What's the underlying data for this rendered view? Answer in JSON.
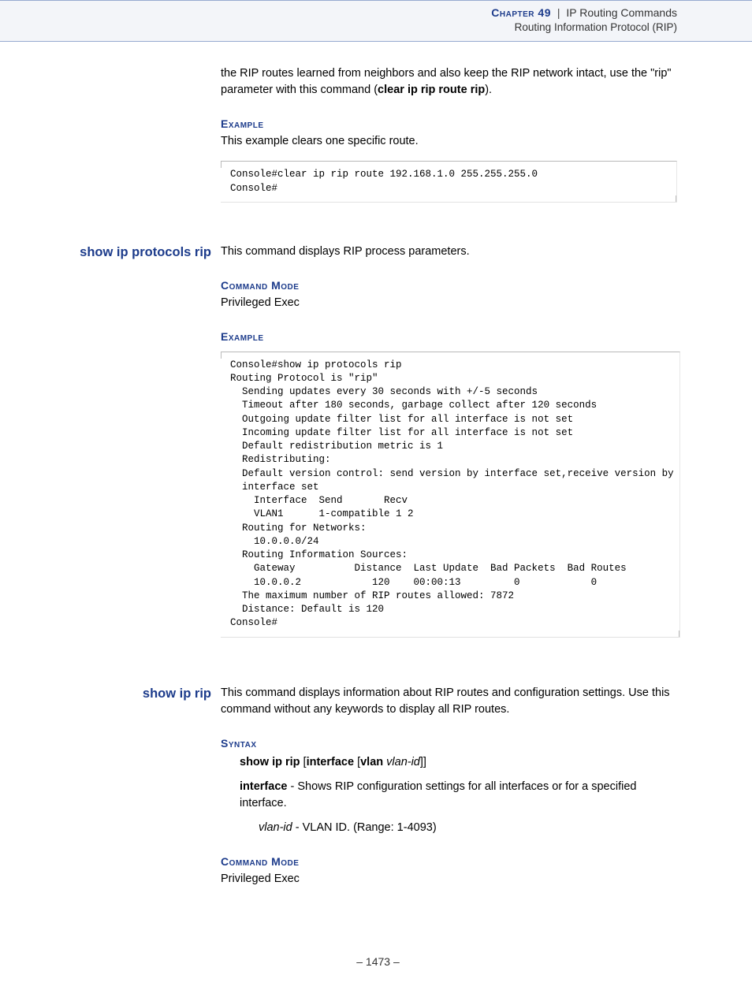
{
  "header": {
    "chapter_label": "Chapter 49",
    "sep": "|",
    "title1": "IP Routing Commands",
    "title2": "Routing Information Protocol (RIP)"
  },
  "intro": {
    "para_pre": "the RIP routes learned from neighbors and also keep the RIP network intact, use the \"rip\" parameter with this command (",
    "para_bold": "clear ip rip route rip",
    "para_post": ").",
    "example_head": "Example",
    "example_text": "This example clears one specific route.",
    "code": "Console#clear ip rip route 192.168.1.0 255.255.255.0\nConsole#"
  },
  "cmd1": {
    "name": "show ip protocols rip",
    "desc": "This command displays RIP process parameters.",
    "mode_head": "Command Mode",
    "mode_text": "Privileged Exec",
    "example_head": "Example",
    "code": "Console#show ip protocols rip\nRouting Protocol is \"rip\"\n  Sending updates every 30 seconds with +/-5 seconds\n  Timeout after 180 seconds, garbage collect after 120 seconds\n  Outgoing update filter list for all interface is not set\n  Incoming update filter list for all interface is not set\n  Default redistribution metric is 1\n  Redistributing:\n  Default version control: send version by interface set,receive version by \n  interface set\n    Interface  Send       Recv\n    VLAN1      1-compatible 1 2\n  Routing for Networks:\n    10.0.0.0/24\n  Routing Information Sources:\n    Gateway          Distance  Last Update  Bad Packets  Bad Routes\n    10.0.0.2            120    00:00:13         0            0\n  The maximum number of RIP routes allowed: 7872\n  Distance: Default is 120\nConsole#"
  },
  "cmd2": {
    "name": "show ip rip",
    "desc": "This command displays information about RIP routes and configuration settings. Use this command without any keywords to display all RIP routes.",
    "syntax_head": "Syntax",
    "syntax_cmd": "show ip rip",
    "syntax_opt1": "interface",
    "syntax_opt2": "vlan",
    "syntax_var": "vlan-id",
    "param1_name": "interface",
    "param1_desc": " - Shows RIP configuration settings for all interfaces or for a specified interface.",
    "param2_name": "vlan-id",
    "param2_desc": " - VLAN ID. (Range: 1-4093)",
    "mode_head": "Command Mode",
    "mode_text": "Privileged Exec"
  },
  "footer": {
    "page": "–  1473  –"
  }
}
